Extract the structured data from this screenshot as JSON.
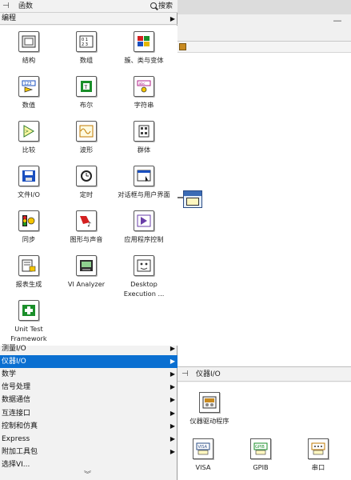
{
  "palette": {
    "title": "函数",
    "search_label": "搜索",
    "top_category": "编程",
    "tiles": [
      {
        "label": "结构",
        "icon": "structures-icon"
      },
      {
        "label": "数组",
        "icon": "array-icon"
      },
      {
        "label": "簇、类与变体",
        "icon": "cluster-class-variant-icon"
      },
      {
        "label": "数值",
        "icon": "numeric-icon"
      },
      {
        "label": "布尔",
        "icon": "boolean-icon"
      },
      {
        "label": "字符串",
        "icon": "string-icon"
      },
      {
        "label": "比较",
        "icon": "comparison-icon"
      },
      {
        "label": "波形",
        "icon": "waveform-icon"
      },
      {
        "label": "群体",
        "icon": "collection-icon"
      },
      {
        "label": "文件I/O",
        "icon": "file-io-icon"
      },
      {
        "label": "定时",
        "icon": "timing-icon"
      },
      {
        "label": "对话框与用户界面",
        "icon": "dialog-ui-icon"
      },
      {
        "label": "同步",
        "icon": "synchronization-icon"
      },
      {
        "label": "图形与声音",
        "icon": "graphics-sound-icon"
      },
      {
        "label": "应用程序控制",
        "icon": "application-control-icon"
      },
      {
        "label": "报表生成",
        "icon": "report-generation-icon"
      },
      {
        "label": "VI Analyzer",
        "icon": "vi-analyzer-icon"
      },
      {
        "label": "Desktop Execution ...",
        "icon": "desktop-execution-icon"
      },
      {
        "label": "Unit Test Framework",
        "icon": "unit-test-framework-icon"
      }
    ],
    "categories": [
      {
        "label": "测量I/O",
        "has_submenu": true,
        "selected": false
      },
      {
        "label": "仪器I/O",
        "has_submenu": true,
        "selected": true
      },
      {
        "label": "数学",
        "has_submenu": true,
        "selected": false
      },
      {
        "label": "信号处理",
        "has_submenu": true,
        "selected": false
      },
      {
        "label": "数据通信",
        "has_submenu": true,
        "selected": false
      },
      {
        "label": "互连接口",
        "has_submenu": true,
        "selected": false
      },
      {
        "label": "控制和仿真",
        "has_submenu": true,
        "selected": false
      },
      {
        "label": "Express",
        "has_submenu": true,
        "selected": false
      },
      {
        "label": "附加工具包",
        "has_submenu": true,
        "selected": false
      },
      {
        "label": "选择VI...",
        "has_submenu": false,
        "selected": false
      }
    ],
    "arrow": "▶",
    "scroll_more": "︾"
  },
  "subpalette": {
    "title": "仪器I/O",
    "items": [
      {
        "label": "仪器驱动程序",
        "icon": "instrument-drivers-icon"
      },
      {
        "label": "VISA",
        "icon": "visa-icon"
      },
      {
        "label": "GPIB",
        "icon": "gpib-icon"
      },
      {
        "label": "串口",
        "icon": "serial-icon"
      }
    ]
  },
  "window": {
    "minimize": "—"
  },
  "colors": {
    "selection": "#0a6fd1",
    "palette_bg": "#f2f2f2"
  }
}
